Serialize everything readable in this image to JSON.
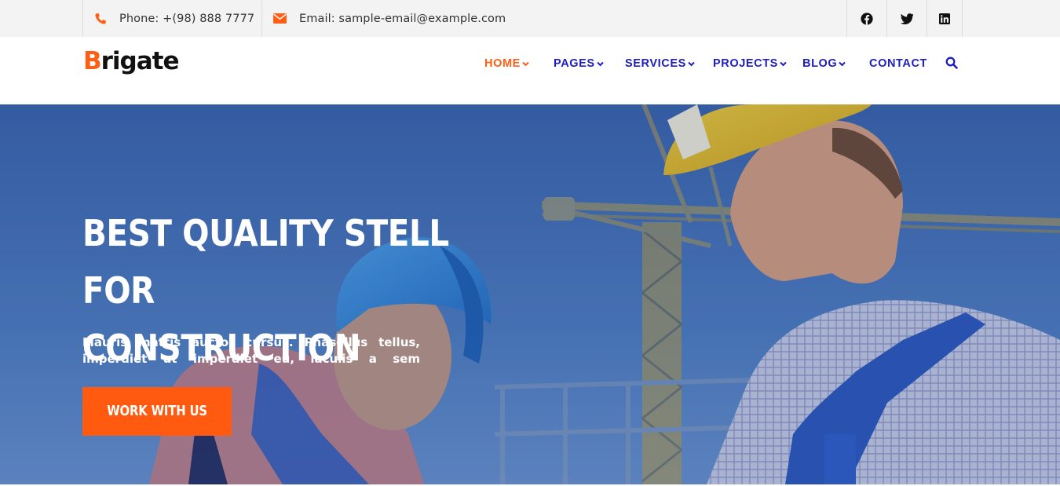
{
  "topbar": {
    "phone": {
      "icon": "phone-icon",
      "text": "Phone: +(98) 888 7777"
    },
    "email": {
      "icon": "envelope-icon",
      "text": "Email: sample-email@example.com"
    },
    "social": [
      {
        "name": "facebook",
        "icon": "facebook-icon"
      },
      {
        "name": "twitter",
        "icon": "twitter-icon"
      },
      {
        "name": "linkedin",
        "icon": "linkedin-icon"
      }
    ]
  },
  "header": {
    "logo_first": "B",
    "logo_rest": "rigate",
    "nav": [
      {
        "label": "HOME",
        "active": true,
        "dropdown": true
      },
      {
        "label": "PAGES",
        "active": false,
        "dropdown": true
      },
      {
        "label": "SERVICES",
        "active": false,
        "dropdown": true
      },
      {
        "label": "PROJECTS",
        "active": false,
        "dropdown": true
      },
      {
        "label": "BLOG",
        "active": false,
        "dropdown": true
      },
      {
        "label": "CONTACT",
        "active": false,
        "dropdown": false
      }
    ],
    "search_icon": "search-icon"
  },
  "hero": {
    "title_line1": "BEST QUALITY STELL FOR",
    "title_line2": "CONSTRUCTION",
    "subtitle": "Mauris mattis auctor cursus. Phasellus tellus, imperdiet ut imperdiet eu, iaculis a sem",
    "cta": "WORK WITH US"
  },
  "colors": {
    "accent": "#ff5e14",
    "nav": "#1d1dc4",
    "topbar_bg": "#f3f3f3",
    "sky": "#4d7cc0"
  }
}
